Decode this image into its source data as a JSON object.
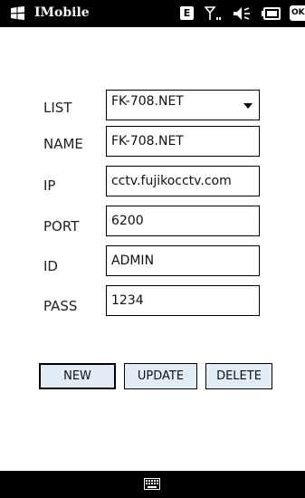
{
  "status_bar": {
    "app_title": "IMobile",
    "e_badge": "E",
    "ok_label": "OK",
    "icons": [
      "windows-flag-icon",
      "e-badge-icon",
      "signal-icon",
      "speaker-icon",
      "battery-icon"
    ]
  },
  "form": {
    "list": {
      "label": "LIST",
      "value": "FK-708.NET"
    },
    "name": {
      "label": "NAME",
      "value": "FK-708.NET"
    },
    "ip": {
      "label": "IP",
      "value": "cctv.fujikocctv.com"
    },
    "port": {
      "label": "PORT",
      "value": "6200"
    },
    "id": {
      "label": "ID",
      "value": "ADMIN"
    },
    "pass": {
      "label": "PASS",
      "value": "1234"
    }
  },
  "buttons": {
    "new_label": "NEW",
    "update_label": "UPDATE",
    "delete_label": "DELETE"
  },
  "bottom_bar": {
    "icons": [
      "keyboard-icon"
    ]
  },
  "colors": {
    "bar_background": "#000000",
    "button_background": "#e1ecf7",
    "field_border": "#000000"
  }
}
